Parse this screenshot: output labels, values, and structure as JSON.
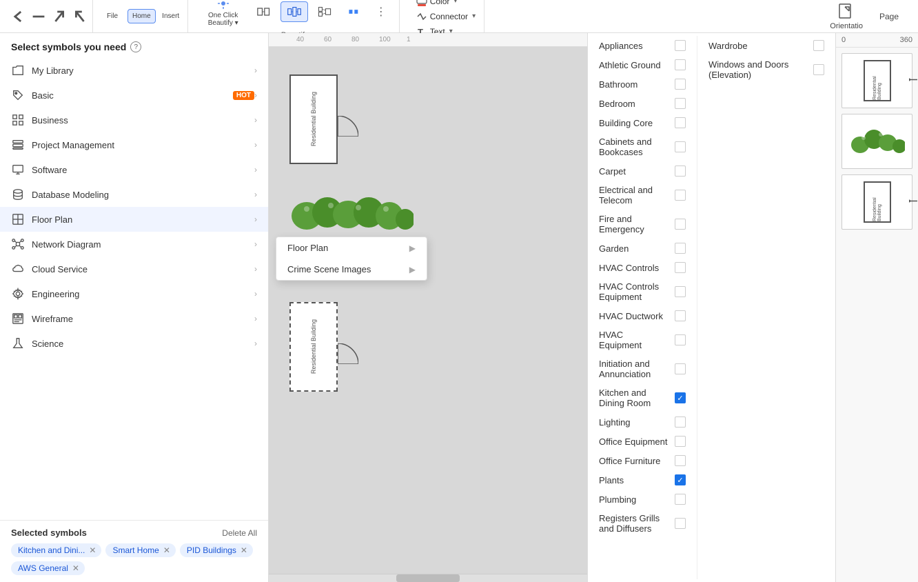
{
  "toolbar": {
    "title": "Home",
    "insert_label": "Insert",
    "one_click_beautify": "One Click\nBeautify",
    "beautify_section_label": "Beautify",
    "color_label": "Color",
    "connector_label": "Connector",
    "text_label": "Text",
    "publish_label": "Orientatio",
    "page_label": "Page"
  },
  "left_panel": {
    "header": "Select symbols you need",
    "menu_items": [
      {
        "id": "my-library",
        "label": "My Library",
        "icon": "folder",
        "has_arrow": true,
        "badge": null
      },
      {
        "id": "basic",
        "label": "Basic",
        "icon": "tag",
        "has_arrow": true,
        "badge": "HOT"
      },
      {
        "id": "business",
        "label": "Business",
        "icon": "grid",
        "has_arrow": true,
        "badge": null
      },
      {
        "id": "project-management",
        "label": "Project Management",
        "icon": "layers",
        "has_arrow": true,
        "badge": null
      },
      {
        "id": "software",
        "label": "Software",
        "icon": "monitor",
        "has_arrow": true,
        "badge": null
      },
      {
        "id": "database-modeling",
        "label": "Database Modeling",
        "icon": "database",
        "has_arrow": true,
        "badge": null
      },
      {
        "id": "floor-plan",
        "label": "Floor Plan",
        "icon": "floor",
        "has_arrow": true,
        "badge": null,
        "active": true
      },
      {
        "id": "network-diagram",
        "label": "Network Diagram",
        "icon": "network",
        "has_arrow": true,
        "badge": null
      },
      {
        "id": "cloud-service",
        "label": "Cloud Service",
        "icon": "cloud",
        "has_arrow": true,
        "badge": null
      },
      {
        "id": "engineering",
        "label": "Engineering",
        "icon": "gear",
        "has_arrow": true,
        "badge": null
      },
      {
        "id": "wireframe",
        "label": "Wireframe",
        "icon": "wireframe",
        "has_arrow": true,
        "badge": null
      },
      {
        "id": "science",
        "label": "Science",
        "icon": "science",
        "has_arrow": true,
        "badge": null
      }
    ],
    "selected_section": {
      "title": "Selected symbols",
      "delete_all": "Delete All",
      "tags": [
        {
          "label": "Kitchen and Dini...",
          "id": "kitchen"
        },
        {
          "label": "Smart Home",
          "id": "smart-home"
        },
        {
          "label": "PID Buildings",
          "id": "pid"
        },
        {
          "label": "AWS General",
          "id": "aws"
        }
      ]
    }
  },
  "canvas_dropdown": {
    "items": [
      {
        "label": "Floor Plan",
        "has_arrow": true
      },
      {
        "label": "Crime Scene Images",
        "has_arrow": true
      }
    ]
  },
  "checklist": {
    "items": [
      {
        "label": "Appliances",
        "checked": false
      },
      {
        "label": "Athletic Ground",
        "checked": false
      },
      {
        "label": "Bathroom",
        "checked": false
      },
      {
        "label": "Bedroom",
        "checked": false
      },
      {
        "label": "Building Core",
        "checked": false
      },
      {
        "label": "Cabinets and Bookcases",
        "checked": false
      },
      {
        "label": "Carpet",
        "checked": false
      },
      {
        "label": "Electrical and Telecom",
        "checked": false
      },
      {
        "label": "Fire and Emergency",
        "checked": false
      },
      {
        "label": "Garden",
        "checked": false
      },
      {
        "label": "HVAC Controls",
        "checked": false
      },
      {
        "label": "HVAC Controls Equipment",
        "checked": false
      },
      {
        "label": "HVAC Ductwork",
        "checked": false
      },
      {
        "label": "HVAC Equipment",
        "checked": false
      },
      {
        "label": "Initiation and Annunciation",
        "checked": false
      },
      {
        "label": "Kitchen and Dining Room",
        "checked": true
      },
      {
        "label": "Lighting",
        "checked": false
      },
      {
        "label": "Office Equipment",
        "checked": false
      },
      {
        "label": "Office Furniture",
        "checked": false
      },
      {
        "label": "Plants",
        "checked": true
      },
      {
        "label": "Plumbing",
        "checked": false
      },
      {
        "label": "Registers Grills and Diffusers",
        "checked": false
      }
    ],
    "right_column": [
      {
        "label": "Wardrobe",
        "checked": false
      },
      {
        "label": "Windows and Doors (Elevation)",
        "checked": false
      }
    ]
  },
  "right_panel": {
    "ruler_left": "0",
    "ruler_right": "360",
    "previews": [
      {
        "label": "Residential Building"
      },
      {
        "label": "Residential Building"
      },
      {
        "label": "Residential Building"
      }
    ]
  },
  "ruler": {
    "marks": [
      "40",
      "60",
      "80",
      "100"
    ]
  }
}
